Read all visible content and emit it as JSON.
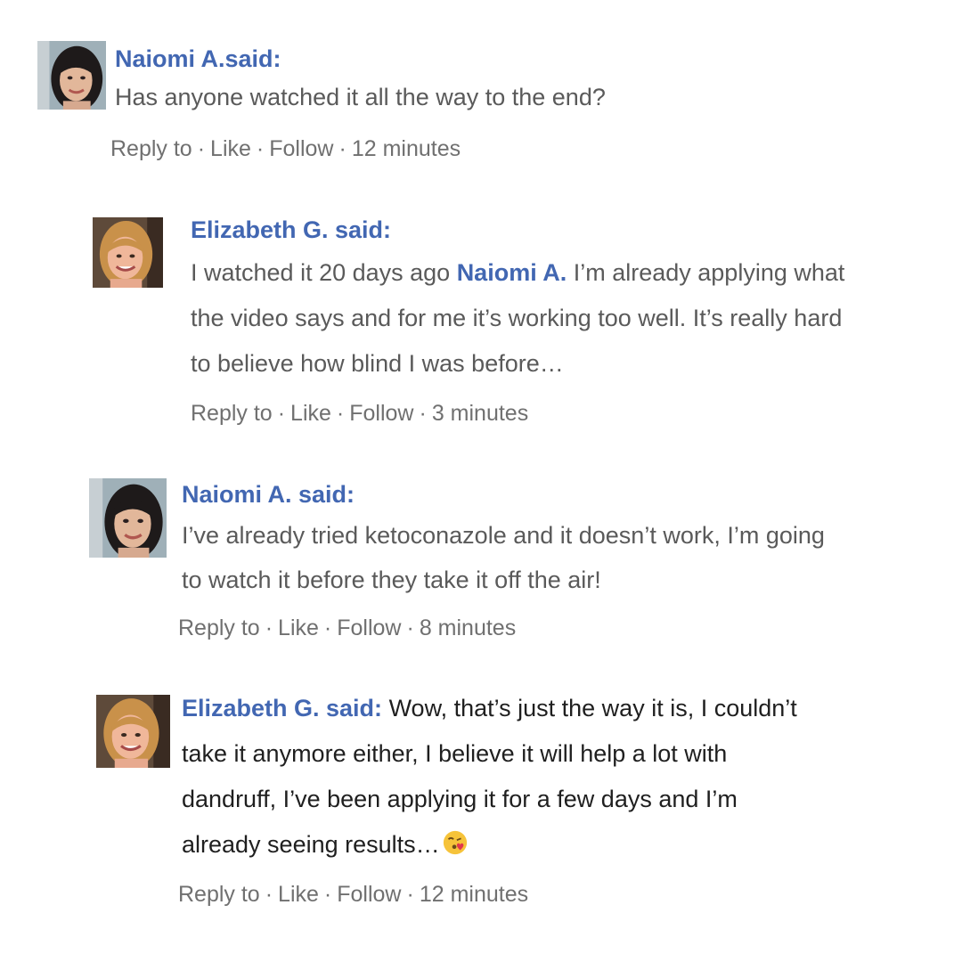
{
  "comments": [
    {
      "author": "Naiomi A.said:",
      "text": "Has anyone watched it all the way to the end?",
      "time": "12 minutes"
    },
    {
      "author": "Elizabeth G. said:",
      "text_before": "I watched it 20 days ago ",
      "mention": "Naiomi A.",
      "text_after": " I’m already applying what the video says and for me it’s working too well. It’s really hard to believe how blind I was before…",
      "time": "3 minutes"
    },
    {
      "author": "Naiomi A. said:",
      "text": "I’ve already tried ketoconazole and it doesn’t work, I’m going to watch it before they take it off the air!",
      "time": "8 minutes"
    },
    {
      "author": "Elizabeth G. said:",
      "text": "Wow, that’s just the way it is, I couldn’t take it anymore either, I believe it will help a lot with dandruff, I’ve been applying it for a few days and I’m already seeing results…",
      "emoji": "face-blowing-kiss-emoji",
      "time": "12 minutes"
    }
  ],
  "actions": {
    "reply": "Reply to",
    "like": "Like",
    "follow": "Follow",
    "separator": "·"
  },
  "colors": {
    "author": "#4267b2",
    "text": "#5a5a5a",
    "meta": "#707070"
  }
}
